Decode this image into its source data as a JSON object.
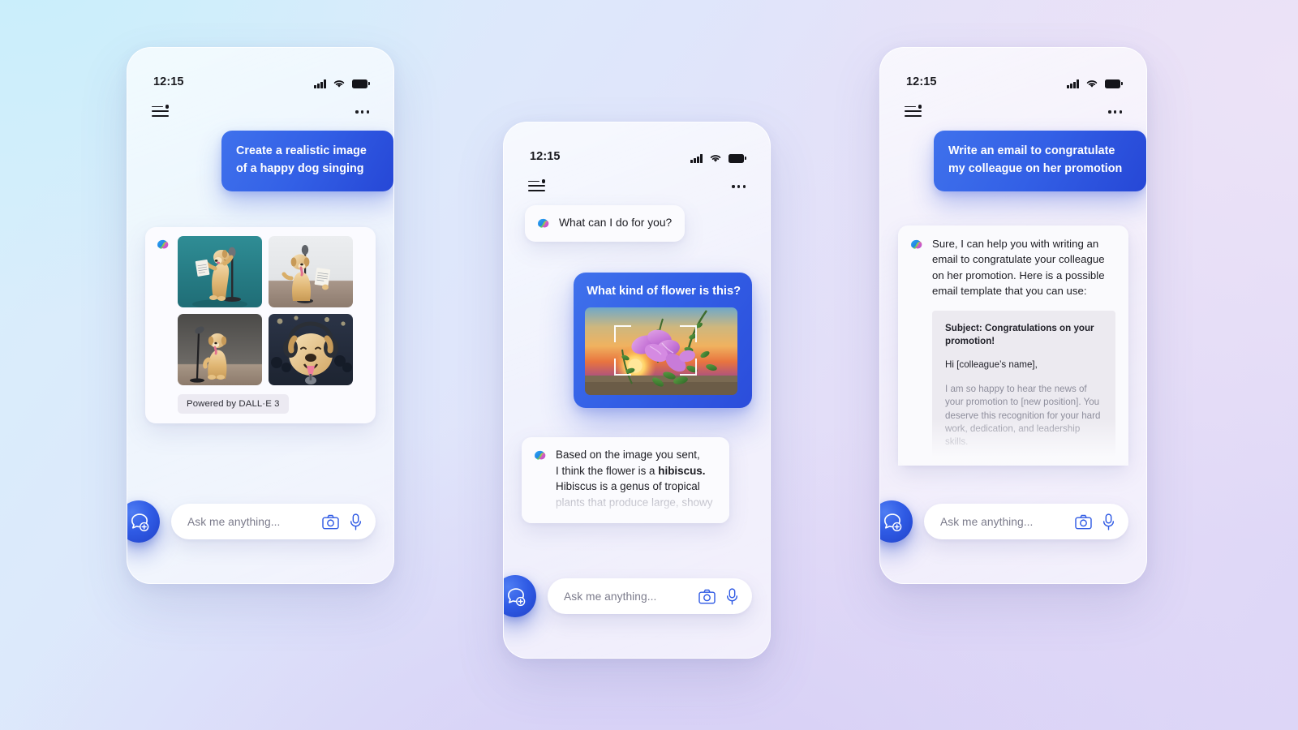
{
  "background": {
    "from": "#d6f0fb",
    "to": "#ddd6f7"
  },
  "accent": {
    "blue": "#3360e6",
    "blue_dark": "#2647d6"
  },
  "statusbar": {
    "time": "12:15",
    "icons": [
      "signal-icon",
      "wifi-icon",
      "battery-icon"
    ]
  },
  "appbar": {
    "menu_icon": "menu-icon",
    "more_icon": "more-options-icon"
  },
  "composer": {
    "new_chat_icon": "new-chat-icon",
    "placeholder": "Ask me anything...",
    "camera_icon": "camera-icon",
    "mic_icon": "microphone-icon"
  },
  "phone1": {
    "user_message": "Create a realistic image of a happy dog singing",
    "assistant": {
      "avatar": "copilot-icon",
      "images": [
        {
          "alt": "golden retriever standing singing into microphone holding sheet music, teal backdrop"
        },
        {
          "alt": "golden retriever sitting singing into microphone with sheet music, grey room"
        },
        {
          "alt": "golden retriever sitting singing into microphone, dark studio backdrop"
        },
        {
          "alt": "golden retriever with headphones singing into microphone on stage"
        }
      ],
      "chip": "Powered by DALL·E 3"
    }
  },
  "phone2": {
    "greeting": "What can I do for you?",
    "user_question": "What kind of flower is this?",
    "photo_alt": "purple hibiscus flowers on a branch at sunset",
    "answer_lines": [
      {
        "text": "Based on the image you sent,",
        "style": "normal"
      },
      {
        "text": "I think the flower is a ",
        "style": "normal",
        "bold_tail": "hibiscus."
      },
      {
        "text": "Hibiscus is a genus of tropical",
        "style": "normal"
      },
      {
        "text": "plants that produce large, showy",
        "style": "dim"
      }
    ]
  },
  "phone3": {
    "user_message": "Write an email to congratulate my colleague on her promotion",
    "answer_intro": "Sure, I can help you with writing an email to congratulate your colleague on her promotion. Here is a possible email template that you can use:",
    "email": {
      "subject": "Subject: Congratulations on your promotion!",
      "greeting": "Hi [colleague’s name],",
      "body": "I am so happy to hear the news of your promotion to [new position]. You deserve this recognition for your hard work, dedication, and leadership skills."
    }
  }
}
